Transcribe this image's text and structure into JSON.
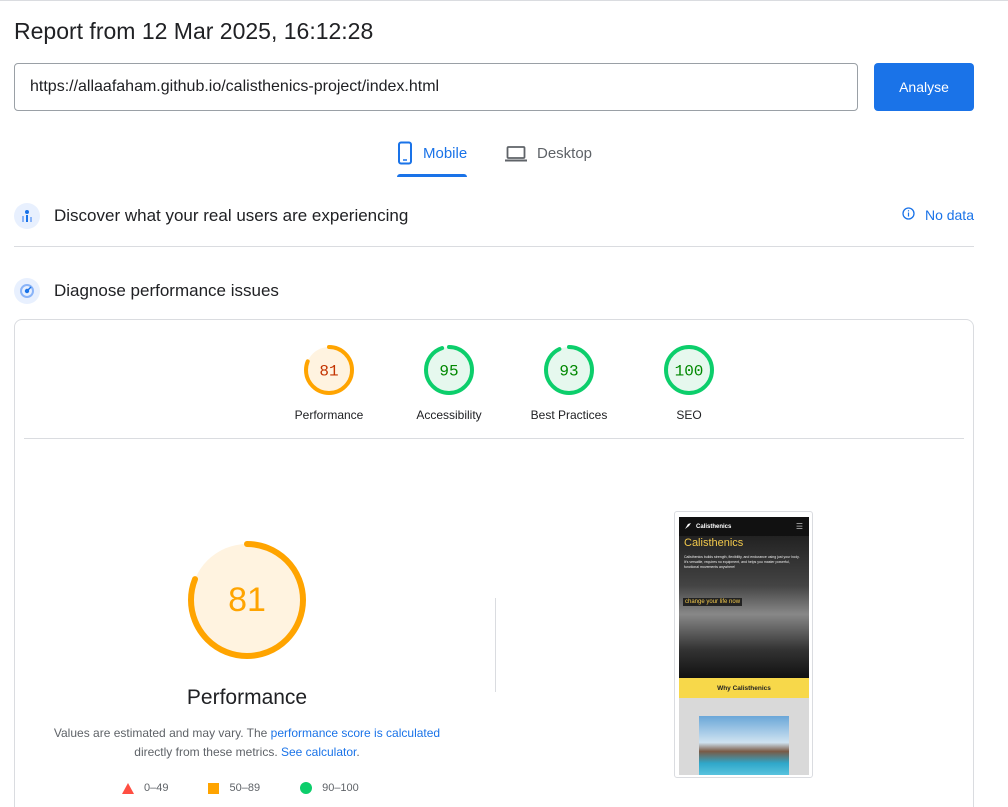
{
  "report": {
    "title": "Report from 12 Mar 2025, 16:12:28"
  },
  "search": {
    "url": "https://allaafaham.github.io/calisthenics-project/index.html",
    "analyse_label": "Analyse"
  },
  "tabs": [
    {
      "label": "Mobile",
      "icon": "phone-icon",
      "active": true
    },
    {
      "label": "Desktop",
      "icon": "laptop-icon",
      "active": false
    }
  ],
  "crux": {
    "title": "Discover what your real users are experiencing",
    "status": "No data",
    "icon": "users-chart-icon",
    "status_icon": "info-icon"
  },
  "diagnose": {
    "title": "Diagnose performance issues",
    "icon": "gauge-icon"
  },
  "scores": [
    {
      "label": "Performance",
      "value": "81",
      "color": "#ffa400",
      "text_color": "#c33300",
      "fill": "#fff3e0"
    },
    {
      "label": "Accessibility",
      "value": "95",
      "color": "#0cce6b",
      "text_color": "#008800",
      "fill": "#e6f8ee"
    },
    {
      "label": "Best Practices",
      "value": "93",
      "color": "#0cce6b",
      "text_color": "#008800",
      "fill": "#e6f8ee"
    },
    {
      "label": "SEO",
      "value": "100",
      "color": "#0cce6b",
      "text_color": "#008800",
      "fill": "#e6f8ee"
    }
  ],
  "performance": {
    "score": "81",
    "heading": "Performance",
    "note_prefix": "Values are estimated and may vary. The ",
    "note_link": "performance score is calculated",
    "note_middle": " directly from these metrics. ",
    "note_link2": "See calculator",
    "note_suffix": ".",
    "legend": [
      {
        "range": "0–49",
        "shape": "triangle",
        "color": "#ff4e42"
      },
      {
        "range": "50–89",
        "shape": "square",
        "color": "#ffa400"
      },
      {
        "range": "90–100",
        "shape": "circle",
        "color": "#0cce6b"
      }
    ]
  },
  "screenshot": {
    "brand": "Calisthenics",
    "title": "Calisthenics",
    "text": "Calisthenics builds strength, flexibility, and endurance using just your body. It's versatile, requires no equipment, and helps you master powerful, functional movements anywhere!",
    "cta": "change your life now",
    "button": "Why Calisthenics"
  }
}
